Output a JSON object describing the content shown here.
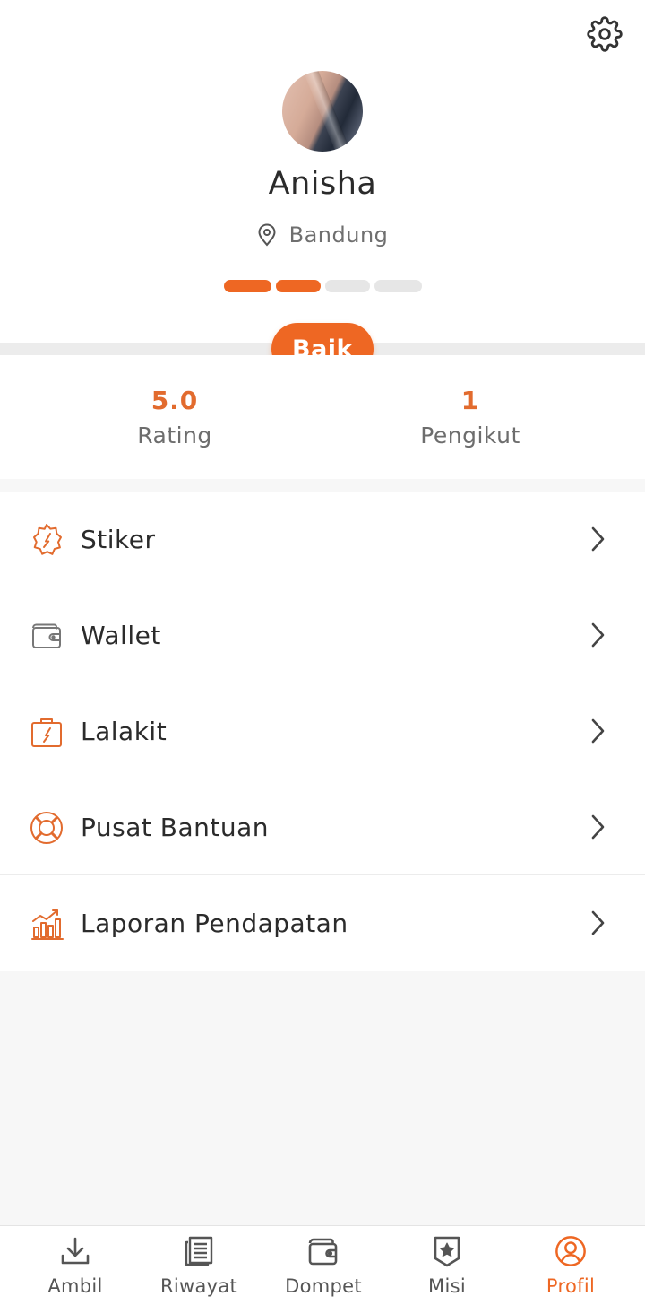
{
  "profile": {
    "name": "Anisha",
    "location": "Bandung",
    "level_segments_filled": 2,
    "level_segments_total": 4,
    "badge": "Baik"
  },
  "stats": {
    "rating": {
      "value": "5.0",
      "label": "Rating"
    },
    "followers": {
      "value": "1",
      "label": "Pengikut"
    }
  },
  "menu": {
    "items": [
      {
        "label": "Stiker",
        "icon": "sticker-badge-icon"
      },
      {
        "label": "Wallet",
        "icon": "wallet-icon"
      },
      {
        "label": "Lalakit",
        "icon": "kit-bag-icon"
      },
      {
        "label": "Pusat Bantuan",
        "icon": "lifebuoy-icon"
      },
      {
        "label": "Laporan Pendapatan",
        "icon": "bar-chart-icon"
      }
    ]
  },
  "bottom_nav": {
    "items": [
      {
        "label": "Ambil",
        "icon": "download-icon"
      },
      {
        "label": "Riwayat",
        "icon": "document-list-icon"
      },
      {
        "label": "Dompet",
        "icon": "wallet-icon"
      },
      {
        "label": "Misi",
        "icon": "star-badge-icon"
      },
      {
        "label": "Profil",
        "icon": "user-icon"
      }
    ],
    "active": "Profil"
  },
  "colors": {
    "accent": "#ee6723",
    "stat_value": "#e26b2e",
    "text_primary": "#2b2b2b",
    "text_secondary": "#6d6d6d",
    "icon_gray": "#555555"
  }
}
